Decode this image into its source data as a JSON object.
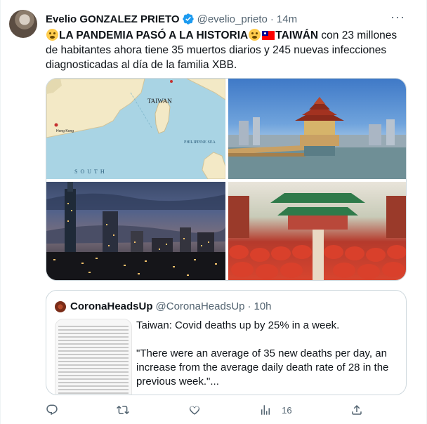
{
  "author": {
    "name": "Evelio GONZALEZ PRIETO",
    "handle": "@evelio_prieto",
    "separator": "·",
    "time": "14m"
  },
  "tweet": {
    "headline_bold": "LA PANDEMIA PASÓ A LA HISTORIA",
    "country_bold": "TAIWÁN",
    "body_line1": " con 23 millones de habitantes ahora tiene 35 muertos diarios y 245 nuevas infecciones diagnosticadas al día de la familia XBB."
  },
  "media": {
    "map_label": "TAIWAN",
    "map_label_2": "PHILIPPINE SEA",
    "map_label_3": "SOUTH",
    "map_label_4": "Hong Kong"
  },
  "quote": {
    "name": "CoronaHeadsUp",
    "handle": "@CoronaHeadsUp",
    "separator": "·",
    "time": "10h",
    "line1": "Taiwan: Covid deaths up by 25% in a week.",
    "line2": "\"There were an average of 35 new deaths per day, an increase from the average daily death rate of 28 in the previous week.\"..."
  },
  "actions": {
    "views_count": "16"
  },
  "icons": {
    "verified": "verified-badge-icon",
    "more": "more-icon",
    "reply": "reply-icon",
    "retweet": "retweet-icon",
    "like": "like-icon",
    "views": "views-icon",
    "share": "share-icon"
  },
  "colors": {
    "verified": "#1d9bf0",
    "secondary_text": "#536471",
    "border": "#cfd9de"
  }
}
